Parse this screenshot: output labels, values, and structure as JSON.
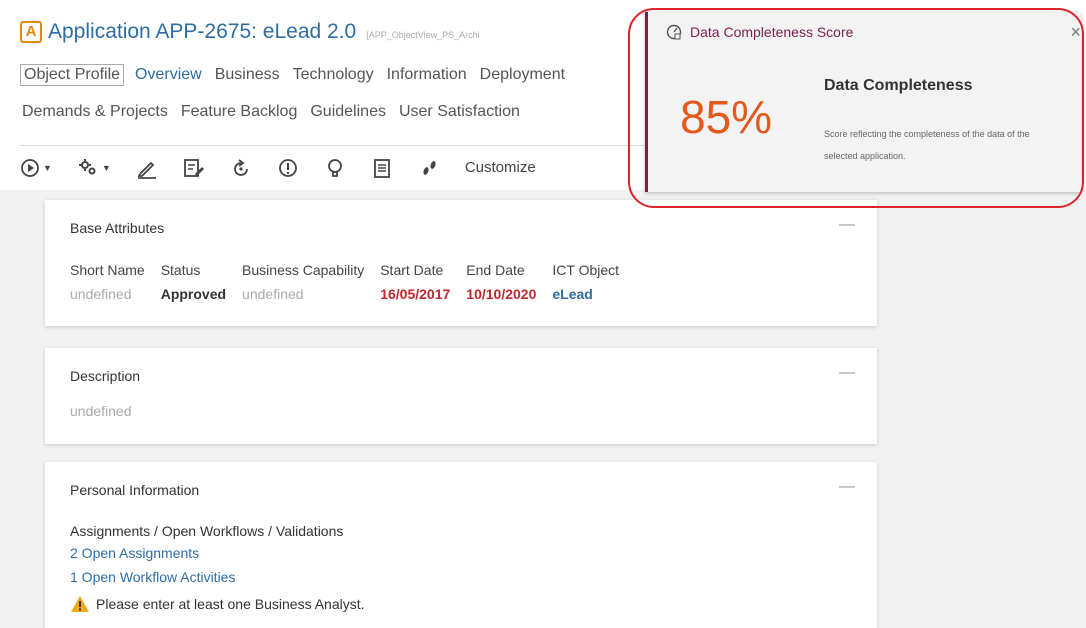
{
  "header": {
    "badge": "A",
    "title": "Application APP-2675: eLead 2.0",
    "object_view_id": "[APP_ObjectView_PS_Archi"
  },
  "tabs_row1": [
    {
      "label": "Object Profile",
      "active": true
    },
    {
      "label": "Overview"
    },
    {
      "label": "Business"
    },
    {
      "label": "Technology"
    },
    {
      "label": "Information"
    },
    {
      "label": "Deployment"
    }
  ],
  "tabs_row2": [
    {
      "label": "Demands & Projects"
    },
    {
      "label": "Feature Backlog"
    },
    {
      "label": "Guidelines"
    },
    {
      "label": "User Satisfaction"
    }
  ],
  "toolbar": {
    "icons": [
      "play-menu-icon",
      "settings-menu-icon",
      "edit-icon",
      "edit-document-icon",
      "refresh-icon",
      "info-icon",
      "lightbulb-icon",
      "clipboard-icon",
      "footsteps-icon"
    ],
    "custom_label": "Customize"
  },
  "base_attributes": {
    "title": "Base Attributes",
    "collapse": "—",
    "columns": [
      {
        "label": "Short Name",
        "value": "undefined"
      },
      {
        "label": "Status",
        "value": "Approved"
      },
      {
        "label": "Business Capability",
        "value": "undefined"
      },
      {
        "label": "Start Date",
        "value": "16/05/2017"
      },
      {
        "label": "End Date",
        "value": "10/10/2020"
      },
      {
        "label": "ICT Object",
        "value": "eLead"
      }
    ]
  },
  "description": {
    "title": "Description",
    "collapse": "—",
    "value": "undefined"
  },
  "personal_information": {
    "title": "Personal Information",
    "collapse": "—",
    "subheading": "Assignments / Open Workflows / Validations",
    "open_assignments": "2 Open Assignments",
    "open_workflows": "1 Open Workflow Activities",
    "warning": "Please enter at least one Business Analyst."
  },
  "popup": {
    "title": "Data Completeness Score",
    "close": "×",
    "score": "85%",
    "heading": "Data Completeness",
    "description": "Score reflecting the completeness of the data of the selected application.",
    "score_color": "#e25a1c",
    "title_color": "#7b1f4c"
  },
  "colors": {
    "link": "#2e6da4",
    "date": "#c0272d",
    "highlight": "#e0242e"
  }
}
